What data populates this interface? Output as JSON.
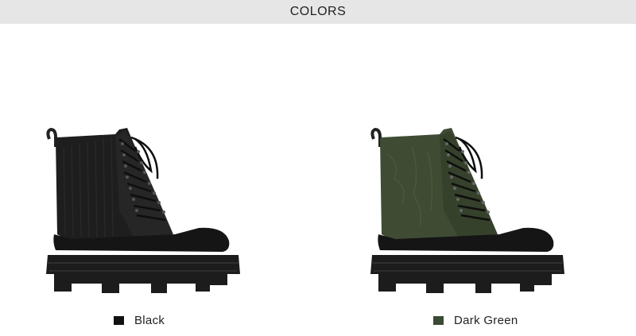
{
  "header": {
    "title": "COLORS"
  },
  "colors": [
    {
      "label": "Black",
      "swatch_color": "#111111",
      "boot_upper_color": "#1e1e1e",
      "image": "black-ankle-boot"
    },
    {
      "label": "Dark Green",
      "swatch_color": "#3a4a33",
      "boot_upper_color": "#3f4c33",
      "image": "dark-green-ankle-boot"
    }
  ],
  "palette": {
    "header_bg": "#e6e6e6",
    "sole": "#1c1c1c",
    "text": "#222222"
  }
}
